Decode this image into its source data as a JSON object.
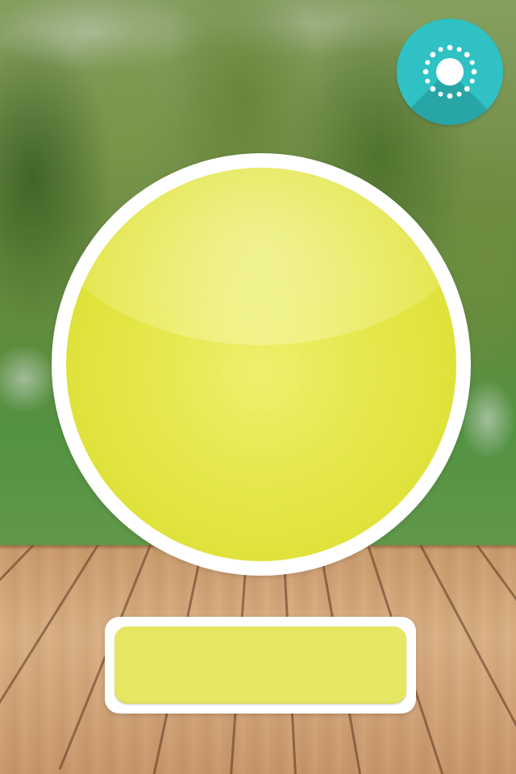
{
  "screen": {
    "ball_color": "#e2e443",
    "accent_color": "#2fc1c3"
  },
  "sun_button": {
    "icon": "sun-icon"
  },
  "ball": {
    "label": ""
  },
  "label_panel": {
    "text": "",
    "fill_color": "#e5e763"
  }
}
